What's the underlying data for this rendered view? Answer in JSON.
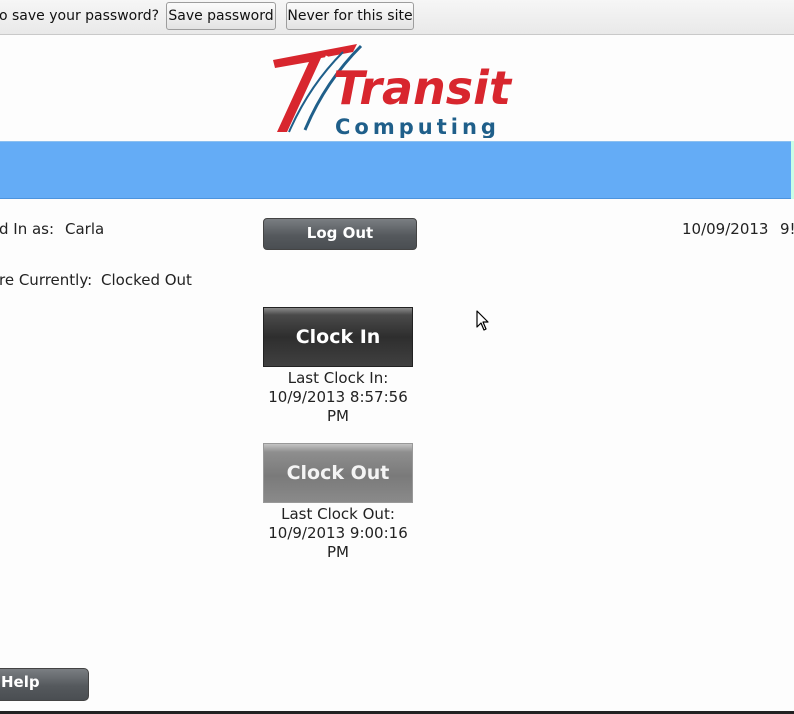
{
  "infobar": {
    "prompt": "o save your password?",
    "save_label": "Save password",
    "never_label": "Never for this site"
  },
  "logo": {
    "word": "Transit",
    "tag": "Computing",
    "brand_red": "#d8262e",
    "brand_blue": "#1f5f8a"
  },
  "colors": {
    "band": "#64acf6",
    "button_dark": "#55595d"
  },
  "session": {
    "logged_in_label": "d In as:",
    "user": "Carla",
    "status_label": "re Currently:",
    "status_value": "Clocked Out",
    "date": "10/09/2013",
    "time_fragment": "9!"
  },
  "buttons": {
    "logout": "Log Out",
    "clock_in": "Clock In",
    "clock_out": "Clock Out",
    "help": "Help"
  },
  "last_clock_in": {
    "label": "Last Clock In:",
    "datetime": "10/9/2013 8:57:56",
    "ampm": "PM"
  },
  "last_clock_out": {
    "label": "Last Clock Out:",
    "datetime": "10/9/2013 9:00:16",
    "ampm": "PM"
  }
}
